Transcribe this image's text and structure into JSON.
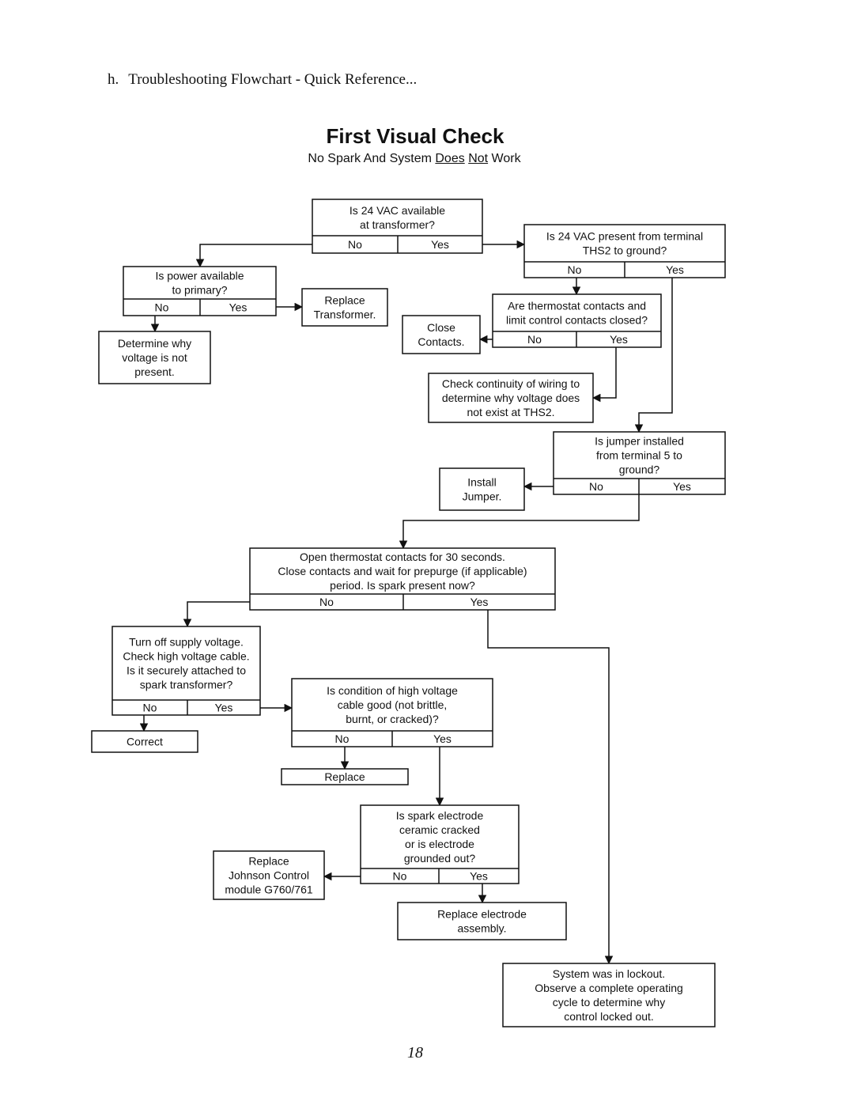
{
  "header": {
    "section_letter": "h.",
    "section_title": "Troubleshooting Flowchart - Quick Reference..."
  },
  "title": "First Visual Check",
  "subtitle": {
    "part1": "No Spark And System ",
    "underlined1": "Does",
    "space": " ",
    "underlined2": "Not",
    "part2": " Work"
  },
  "page_number": "18",
  "nodes": {
    "q_24vac_transformer": {
      "lines": [
        "Is 24 VAC available",
        "at transformer?"
      ],
      "no": "No",
      "yes": "Yes"
    },
    "q_power_primary": {
      "lines": [
        "Is power available",
        "to primary?"
      ],
      "no": "No",
      "yes": "Yes"
    },
    "a_replace_transformer": {
      "lines": [
        "Replace",
        "Transformer."
      ]
    },
    "a_determine_voltage": {
      "lines": [
        "Determine why",
        "voltage is not",
        "present."
      ]
    },
    "q_24vac_ths2": {
      "lines": [
        "Is 24 VAC present from terminal",
        "THS2 to ground?"
      ],
      "no": "No",
      "yes": "Yes"
    },
    "q_contacts_closed": {
      "lines": [
        "Are thermostat contacts and",
        "limit control contacts closed?"
      ],
      "no": "No",
      "yes": "Yes"
    },
    "a_close_contacts": {
      "lines": [
        "Close",
        "Contacts."
      ]
    },
    "a_check_continuity": {
      "lines": [
        "Check continuity of wiring to",
        "determine why voltage does",
        "not exist at THS2."
      ]
    },
    "q_jumper": {
      "lines": [
        "Is jumper installed",
        "from terminal 5 to",
        "ground?"
      ],
      "no": "No",
      "yes": "Yes"
    },
    "a_install_jumper": {
      "lines": [
        "Install",
        "Jumper."
      ]
    },
    "q_spark_present": {
      "lines": [
        "Open thermostat contacts for 30 seconds.",
        "Close contacts and wait for prepurge (if applicable)",
        "period.  Is spark present now?"
      ],
      "no": "No",
      "yes": "Yes"
    },
    "q_cable_attached": {
      "lines": [
        "Turn off supply voltage.",
        "Check high voltage cable.",
        "Is it securely attached to",
        "spark transformer?"
      ],
      "no": "No",
      "yes": "Yes"
    },
    "a_correct": {
      "lines": [
        "Correct"
      ]
    },
    "q_cable_condition": {
      "lines": [
        "Is condition of high voltage",
        "cable good (not brittle,",
        "burnt, or cracked)?"
      ],
      "no": "No",
      "yes": "Yes"
    },
    "a_replace": {
      "lines": [
        "Replace"
      ]
    },
    "q_electrode": {
      "lines": [
        "Is spark electrode",
        "ceramic cracked",
        "or is electrode",
        "grounded out?"
      ],
      "no": "No",
      "yes": "Yes"
    },
    "a_replace_module": {
      "lines": [
        "Replace",
        "Johnson Control",
        "module G760/761"
      ]
    },
    "a_replace_electrode": {
      "lines": [
        "Replace electrode",
        "assembly."
      ]
    },
    "a_lockout": {
      "lines": [
        "System was in lockout.",
        "Observe a complete operating",
        "cycle to determine why",
        "control locked out."
      ]
    }
  }
}
